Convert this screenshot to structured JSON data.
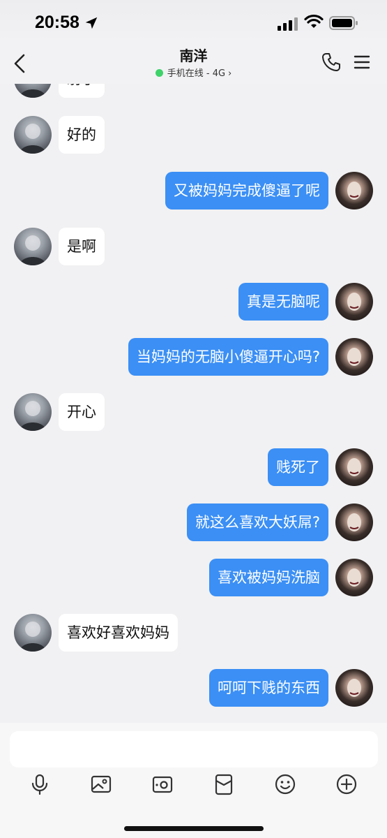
{
  "status_bar": {
    "time": "20:58"
  },
  "header": {
    "title": "南洋",
    "status": "手机在线 - 4G",
    "status_chevron": "›",
    "online_color": "#3fd26a"
  },
  "messages": [
    {
      "side": "left",
      "text": "射了",
      "partial": true
    },
    {
      "side": "left",
      "text": "好的"
    },
    {
      "side": "right",
      "text": "又被妈妈完成傻逼了呢"
    },
    {
      "side": "left",
      "text": "是啊"
    },
    {
      "side": "right",
      "text": "真是无脑呢"
    },
    {
      "side": "right",
      "text": "当妈妈的无脑小傻逼开心吗?"
    },
    {
      "side": "left",
      "text": "开心"
    },
    {
      "side": "right",
      "text": "贱死了"
    },
    {
      "side": "right",
      "text": "就这么喜欢大妖屌?"
    },
    {
      "side": "right",
      "text": "喜欢被妈妈洗脑"
    },
    {
      "side": "left",
      "text": "喜欢好喜欢妈妈"
    },
    {
      "side": "right",
      "text": "呵呵下贱的东西"
    }
  ],
  "input": {
    "placeholder": ""
  },
  "toolbar": [
    "mic-icon",
    "image-icon",
    "camera-icon",
    "red-packet-icon",
    "emoji-icon",
    "plus-icon"
  ],
  "colors": {
    "bubble_self": "#3b8ff5",
    "bubble_other": "#ffffff",
    "background": "#f1f1f3"
  }
}
